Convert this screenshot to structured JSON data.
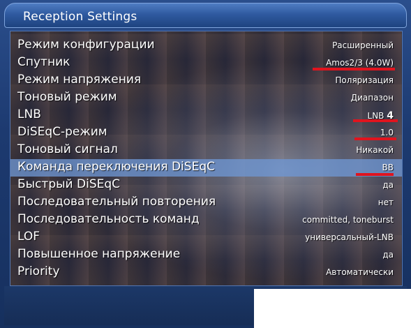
{
  "window": {
    "title": "Reception Settings"
  },
  "settings": [
    {
      "label": "Режим конфигурации",
      "value": "Расширенный"
    },
    {
      "label": "Спутник",
      "value": "Amos2/3 (4.0W)"
    },
    {
      "label": "Режим напряжения",
      "value": "Поляризация"
    },
    {
      "label": "Тоновый режим",
      "value": "Диапазон"
    },
    {
      "label": "LNB",
      "value": "LNB",
      "value_bold": "4"
    },
    {
      "label": "DiSEqC-режим",
      "value": "1.0"
    },
    {
      "label": "Тоновый сигнал",
      "value": "Никакой"
    },
    {
      "label": "Команда переключения DiSEqC",
      "value": "BB"
    },
    {
      "label": "Быстрый DiSEqC",
      "value": "да"
    },
    {
      "label": "Последовательный повторения",
      "value": "нет"
    },
    {
      "label": "Последовательность команд",
      "value": "committed, toneburst"
    },
    {
      "label": "LOF",
      "value": "универсальный-LNB"
    },
    {
      "label": "Повышенное напряжение",
      "value": "да"
    },
    {
      "label": "Priority",
      "value": "Автоматически"
    }
  ],
  "selected_index": 7,
  "colors": {
    "highlight": "#6e96d2",
    "annotation": "#e0141e",
    "title_bar": "#2f5aa0"
  }
}
